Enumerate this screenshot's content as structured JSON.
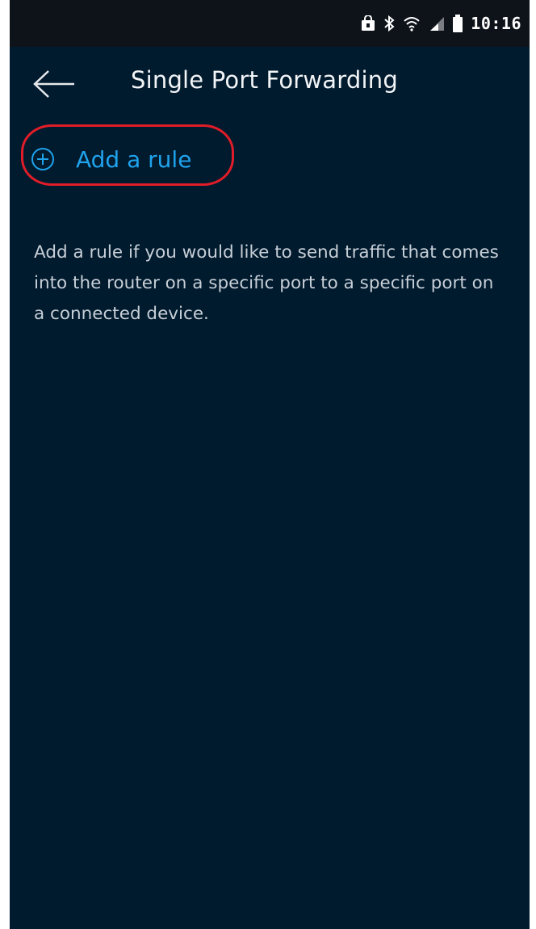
{
  "status_bar": {
    "time": "10:16",
    "icons": [
      "lock-icon",
      "bluetooth-icon",
      "wifi-icon",
      "signal-icon",
      "battery-icon"
    ]
  },
  "header": {
    "back_icon": "back-arrow-icon",
    "title": "Single Port Forwarding"
  },
  "add_rule": {
    "icon": "plus-circle-icon",
    "label": "Add a rule",
    "highlighted": true
  },
  "description": "Add a rule if you would like to send traffic that comes into the router on a specific port to a specific port on a connected device.",
  "colors": {
    "background": "#001A2E",
    "status_bar": "#0E131A",
    "accent": "#1FA3EC",
    "highlight": "#E01D28",
    "text": "#C7CFD7"
  }
}
